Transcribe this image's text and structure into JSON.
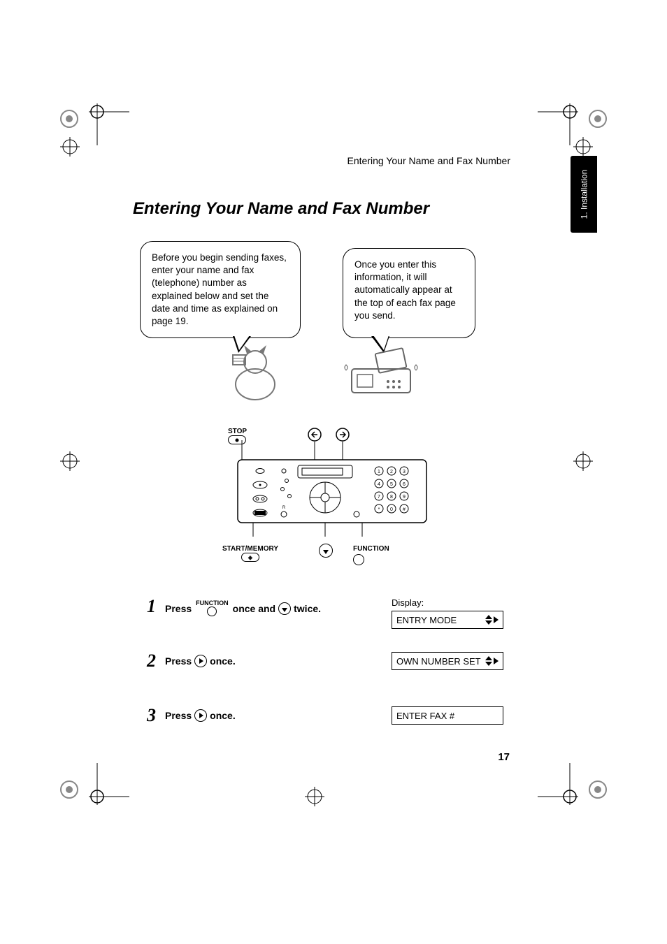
{
  "running_header": "Entering Your Name and Fax Number",
  "section_title": "Entering Your Name and Fax Number",
  "side_tab": "1. Installation",
  "callouts": {
    "left": "Before you begin sending faxes, enter your name and fax (telephone) number as explained below and set the date and time as explained on page 19.",
    "right": "Once you enter this information, it will automatically appear at the top of each fax page you send."
  },
  "panel": {
    "stop_label": "STOP",
    "start_label": "START/MEMORY",
    "function_label": "FUNCTION",
    "keypad": [
      "1",
      "2",
      "3",
      "4",
      "5",
      "6",
      "7",
      "8",
      "9",
      "*",
      "0",
      "#"
    ]
  },
  "steps": [
    {
      "num": "1",
      "press": "Press",
      "fn_label": "FUNCTION",
      "mid": "once and",
      "end": "twice.",
      "display_label": "Display:",
      "lcd": "ENTRY MODE",
      "nav": "updown-right"
    },
    {
      "num": "2",
      "press": "Press",
      "end": "once.",
      "lcd": "OWN NUMBER SET",
      "nav": "updown-right"
    },
    {
      "num": "3",
      "press": "Press",
      "end": "once.",
      "lcd": "ENTER FAX #",
      "nav": "none"
    }
  ],
  "page_number": "17"
}
